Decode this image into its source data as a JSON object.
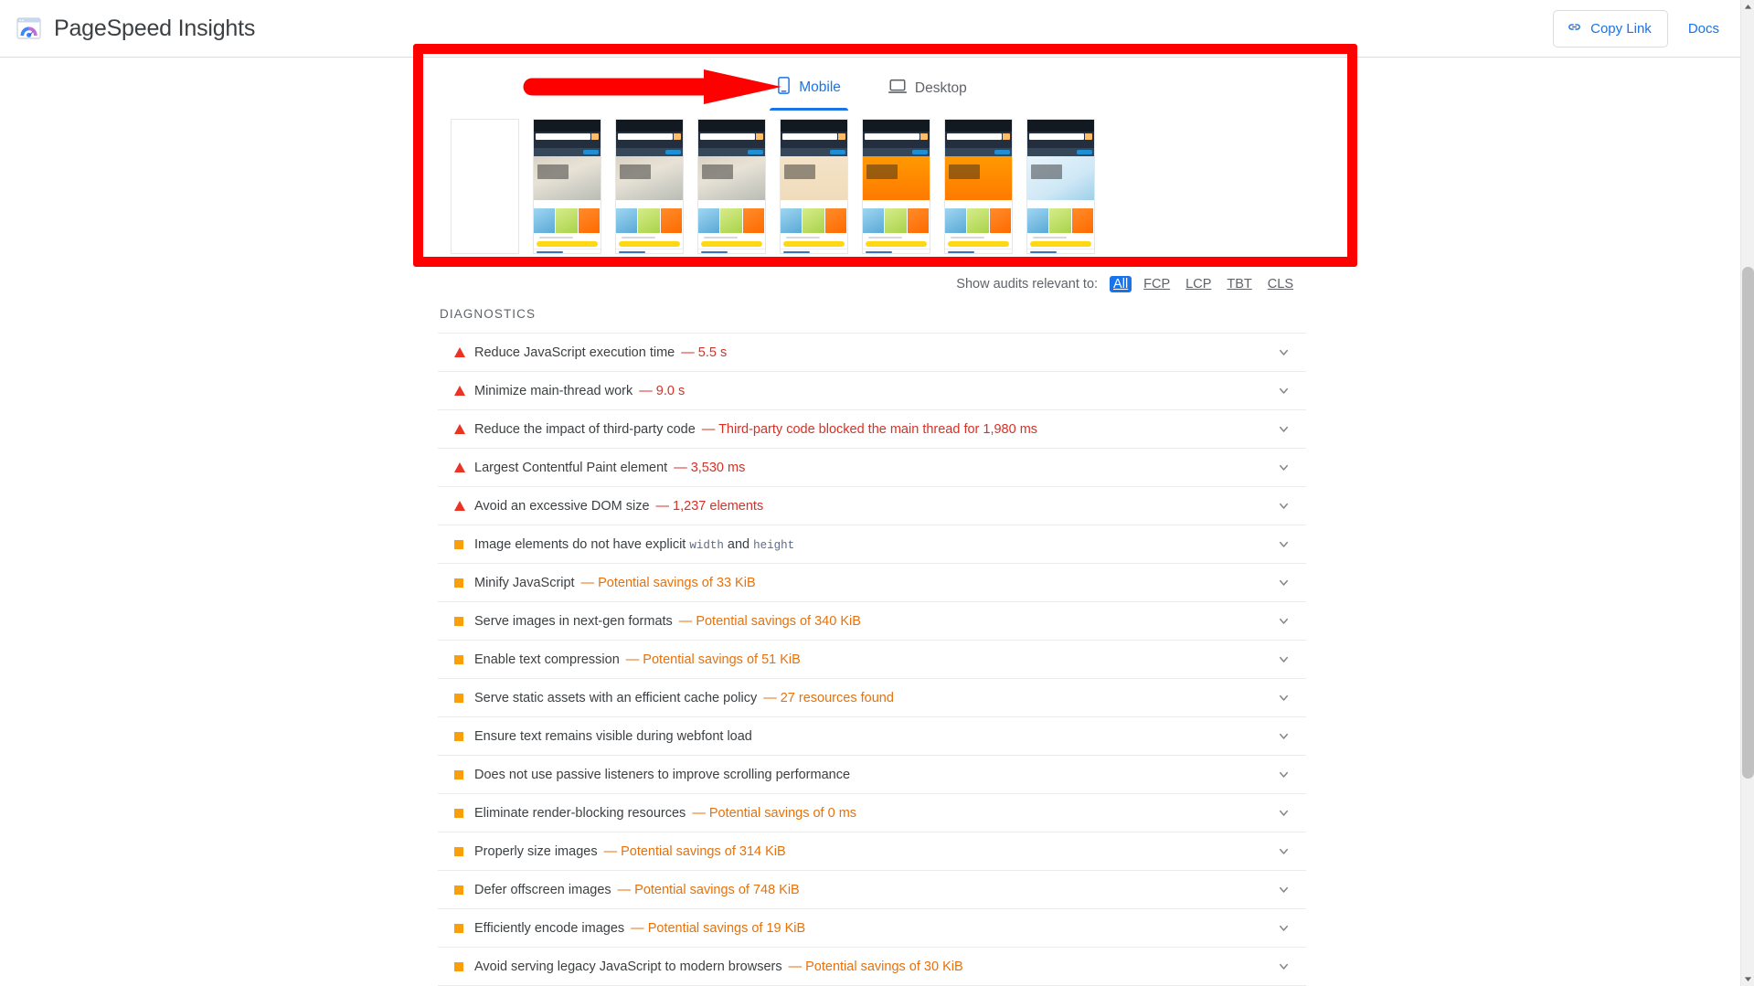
{
  "header": {
    "brand_title": "PageSpeed Insights",
    "logo_icon": "pagespeed-logo-icon",
    "copy_link_label": "Copy Link",
    "copy_link_icon": "link-icon",
    "docs_label": "Docs"
  },
  "tabs": [
    {
      "label": "Mobile",
      "icon": "mobile-phone-icon",
      "active": true
    },
    {
      "label": "Desktop",
      "icon": "desktop-monitor-icon",
      "active": false
    }
  ],
  "filmstrip": {
    "frames": [
      {
        "state": "blank"
      },
      {
        "state": "hero-window"
      },
      {
        "state": "hero-window"
      },
      {
        "state": "hero-window"
      },
      {
        "state": "hero-garfield-faded"
      },
      {
        "state": "hero-garfield"
      },
      {
        "state": "hero-garfield"
      },
      {
        "state": "hero-skincare"
      }
    ]
  },
  "audit_filter": {
    "label": "Show audits relevant to:",
    "options": [
      {
        "label": "All",
        "selected": true
      },
      {
        "label": "FCP",
        "selected": false
      },
      {
        "label": "LCP",
        "selected": false
      },
      {
        "label": "TBT",
        "selected": false
      },
      {
        "label": "CLS",
        "selected": false
      }
    ]
  },
  "diagnostics": {
    "heading": "DIAGNOSTICS",
    "audits": [
      {
        "marker": "fail",
        "title": "Reduce JavaScript execution time",
        "dash": "—",
        "value": "5.5 s"
      },
      {
        "marker": "fail",
        "title": "Minimize main-thread work",
        "dash": "—",
        "value": "9.0 s"
      },
      {
        "marker": "fail",
        "title": "Reduce the impact of third-party code",
        "dash": "—",
        "value": "Third-party code blocked the main thread for 1,980 ms"
      },
      {
        "marker": "fail",
        "title": "Largest Contentful Paint element",
        "dash": "—",
        "value": "3,530 ms"
      },
      {
        "marker": "fail",
        "title": "Avoid an excessive DOM size",
        "dash": "—",
        "value": "1,237 elements"
      },
      {
        "marker": "average",
        "title_html": "Image elements do not have explicit <code>width</code> and <code>height</code>",
        "dash": "",
        "value": ""
      },
      {
        "marker": "average",
        "title": "Minify JavaScript",
        "dash": "—",
        "value": "Potential savings of 33 KiB"
      },
      {
        "marker": "average",
        "title": "Serve images in next-gen formats",
        "dash": "—",
        "value": "Potential savings of 340 KiB"
      },
      {
        "marker": "average",
        "title": "Enable text compression",
        "dash": "—",
        "value": "Potential savings of 51 KiB"
      },
      {
        "marker": "average",
        "title": "Serve static assets with an efficient cache policy",
        "dash": "—",
        "value": "27 resources found"
      },
      {
        "marker": "average",
        "title": "Ensure text remains visible during webfont load",
        "dash": "",
        "value": ""
      },
      {
        "marker": "average",
        "title": "Does not use passive listeners to improve scrolling performance",
        "dash": "",
        "value": ""
      },
      {
        "marker": "average",
        "title": "Eliminate render-blocking resources",
        "dash": "—",
        "value": "Potential savings of 0 ms"
      },
      {
        "marker": "average",
        "title": "Properly size images",
        "dash": "—",
        "value": "Potential savings of 314 KiB"
      },
      {
        "marker": "average",
        "title": "Defer offscreen images",
        "dash": "—",
        "value": "Potential savings of 748 KiB"
      },
      {
        "marker": "average",
        "title": "Efficiently encode images",
        "dash": "—",
        "value": "Potential savings of 19 KiB"
      },
      {
        "marker": "average",
        "title": "Avoid serving legacy JavaScript to modern browsers",
        "dash": "—",
        "value": "Potential savings of 30 KiB"
      }
    ]
  },
  "annotations": {
    "box_color": "#ff0000",
    "arrow_color": "#ff0000",
    "arrow_points_to": "Mobile"
  },
  "colors": {
    "accent_blue": "#1a73e8",
    "fail_red": "#d93025",
    "fail_marker": "#ea3323",
    "average_orange": "#fa9f0a",
    "average_text": "#e8710a",
    "text_primary": "#3c4043",
    "text_secondary": "#5f6368",
    "border": "#ebebeb"
  },
  "scrollbar": {
    "visible": true,
    "thumb_position": "middle"
  }
}
